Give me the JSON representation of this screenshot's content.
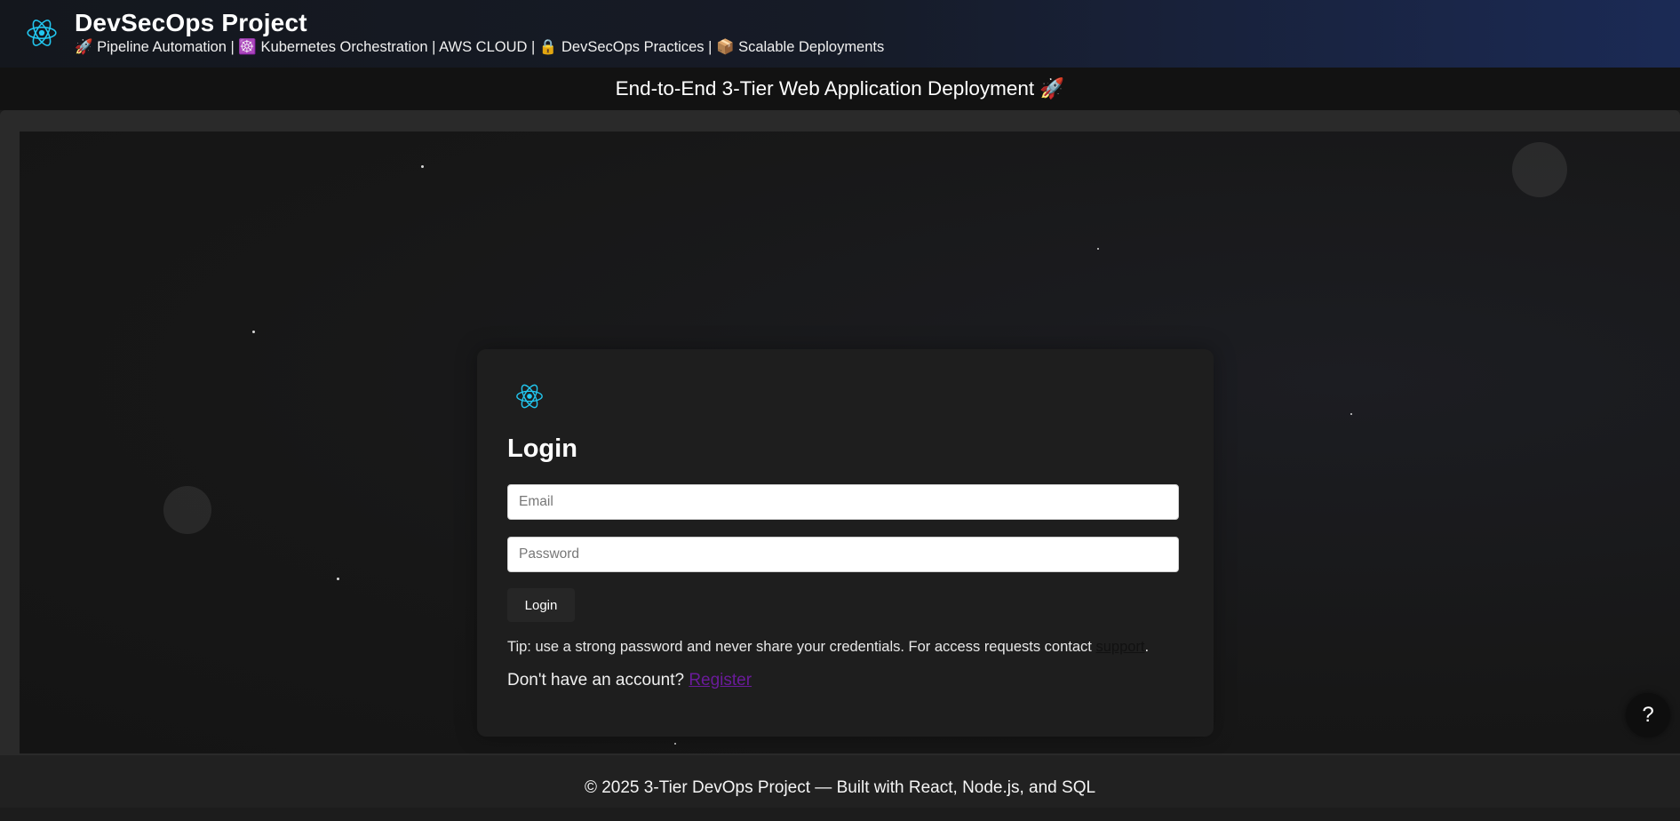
{
  "header": {
    "title": "DevSecOps Project",
    "tagline": "🚀 Pipeline Automation | ☸️ Kubernetes Orchestration | AWS CLOUD | 🔒 DevSecOps Practices | 📦 Scalable Deployments",
    "logo_icon": "react-atom-icon"
  },
  "banner": {
    "text": "End-to-End 3-Tier Web Application Deployment 🚀"
  },
  "login": {
    "heading": "Login",
    "email_placeholder": "Email",
    "password_placeholder": "Password",
    "button_label": "Login",
    "tip_text": "Tip: use a strong password and never share your credentials. For access requests contact ",
    "support_link": "support",
    "tip_end": ".",
    "register_prompt": "Don't have an account? ",
    "register_link": "Register"
  },
  "help": {
    "label": "?"
  },
  "footer": {
    "text": "© 2025 3-Tier DevOps Project — Built with React, Node.js, and SQL"
  },
  "colors": {
    "accent": "#22c7f0",
    "register_link": "#6a1b9a",
    "header_gradient_end": "#1b2a55"
  }
}
